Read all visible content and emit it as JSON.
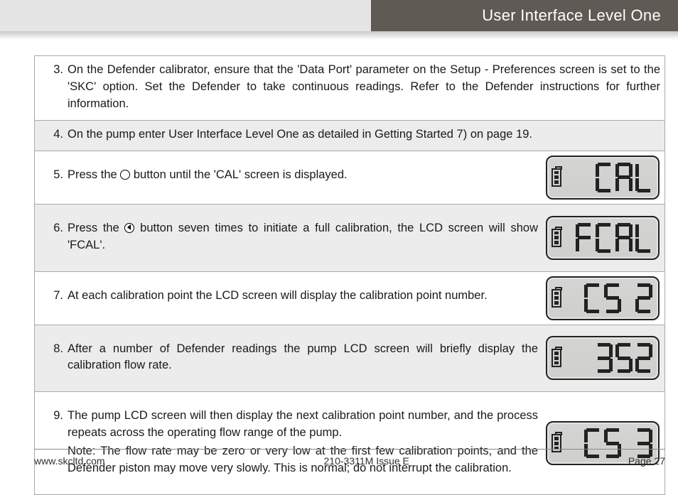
{
  "header": {
    "title": "User Interface Level One"
  },
  "steps": [
    {
      "n": "3.",
      "text": "On the Defender calibrator, ensure that the 'Data Port' parameter on the Setup - Preferences screen is set to the 'SKC' option. Set the Defender to take continuous readings. Refer to the Defender instructions for further information.",
      "shade": false,
      "lcd": null
    },
    {
      "n": "4.",
      "text": "On the pump enter User Interface Level One as detailed in Getting Started 7) on page 19.",
      "shade": true,
      "lcd": null
    },
    {
      "n": "5.",
      "pre": "Press the ",
      "post": " button until the 'CAL' screen is displayed.",
      "btn": "circle",
      "shade": false,
      "lcd": "CAL"
    },
    {
      "n": "6.",
      "pre": "Press the ",
      "post": " button seven times to initiate a full calibration, the LCD screen will show 'FCAL'.",
      "btn": "left",
      "shade": true,
      "lcd": "FCAL"
    },
    {
      "n": "7.",
      "text": "At each calibration point the LCD screen will display the calibration point number.",
      "shade": false,
      "lcd": "CS 2"
    },
    {
      "n": "8.",
      "text": "After a number of Defender readings the pump LCD screen will briefly display the calibration flow rate.",
      "shade": true,
      "lcd": " 352"
    },
    {
      "n": "9.",
      "text": "The pump LCD screen will then display the next calibration point number, and the process repeats across the operating flow range of the pump.",
      "note": "Note: The flow rate may be zero or very low at the first few calibration points, and the Defender piston may move very slowly. This is normal; do not interrupt the calibration.",
      "shade": false,
      "lcd": "CS 3"
    }
  ],
  "footer": {
    "left": "www.skcltd.com",
    "center": "210-3311M Issue E",
    "right": "Page 27"
  },
  "segmap": {
    "0": "ABCDEF",
    "1": "BC",
    "2": "ABDEG",
    "3": "ABCDG",
    "4": "BCFG",
    "5": "ACDFG",
    "6": "ACDEFG",
    "7": "ABC",
    "8": "ABCDEFG",
    "9": "ABCDFG",
    "C": "ADEF",
    "A": "ABCEFG",
    "L": "DEF",
    "F": "AEFG",
    "S": "ACDFG",
    " ": ""
  }
}
